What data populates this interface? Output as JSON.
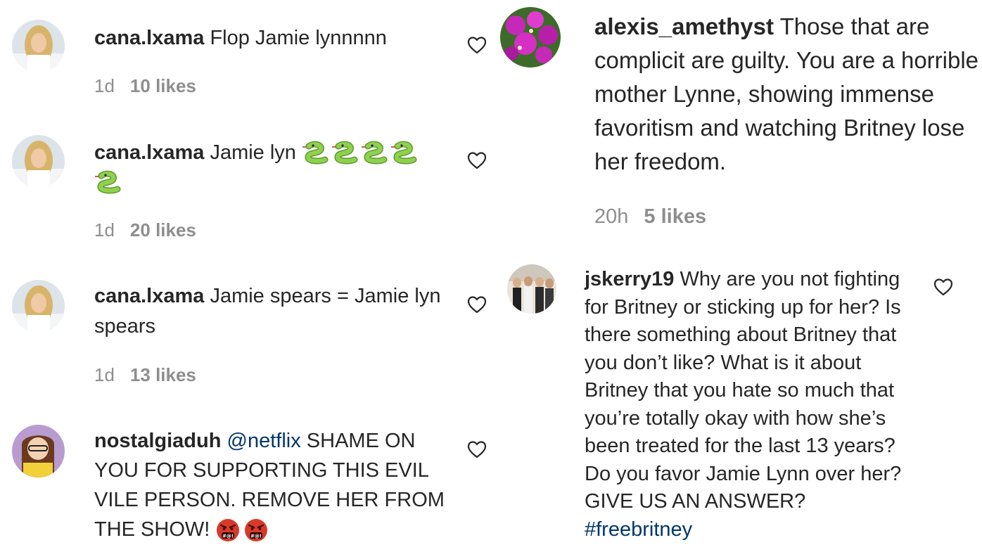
{
  "left": {
    "c1": {
      "username": "cana.lxama",
      "text": "Flop Jamie lynnnnn",
      "time": "1d",
      "likes": "10 likes"
    },
    "c2": {
      "username": "cana.lxama",
      "text": "Jamie lyn",
      "time": "1d",
      "likes": "20 likes",
      "emoji": "snake-emoji x5"
    },
    "c3": {
      "username": "cana.lxama",
      "text": "Jamie spears = Jamie lyn spears",
      "time": "1d",
      "likes": "13 likes"
    },
    "c4": {
      "username": "nostalgiaduh",
      "mention": "@netflix",
      "text": "SHAME ON YOU FOR SUPPORTING THIS EVIL VILE PERSON. REMOVE HER FROM THE SHOW!",
      "emoji": "cursing-face-emoji x2"
    }
  },
  "right": {
    "c1": {
      "username": "alexis_amethyst",
      "text": "Those that are complicit are guilty. You are a horrible mother Lynne, showing immense favoritism and watching Britney lose her freedom.",
      "time": "20h",
      "likes": "5 likes"
    },
    "c2": {
      "username": "jskerry19",
      "text": "Why are you not fighting for Britney or sticking up for her? Is there something about Britney that you don’t like? What is it about Britney that you hate so much that you’re totally okay with how she’s been treated for the last 13 years? Do you favor Jamie Lynn over her? GIVE US AN ANSWER?",
      "hashtag": "#freebritney"
    }
  },
  "colors": {
    "text": "#262626",
    "meta": "#8e8e8e",
    "link": "#00376b",
    "snake": "#7cc242",
    "angry": "#d83a2a"
  },
  "icons": {
    "like": "heart-outline-icon"
  }
}
